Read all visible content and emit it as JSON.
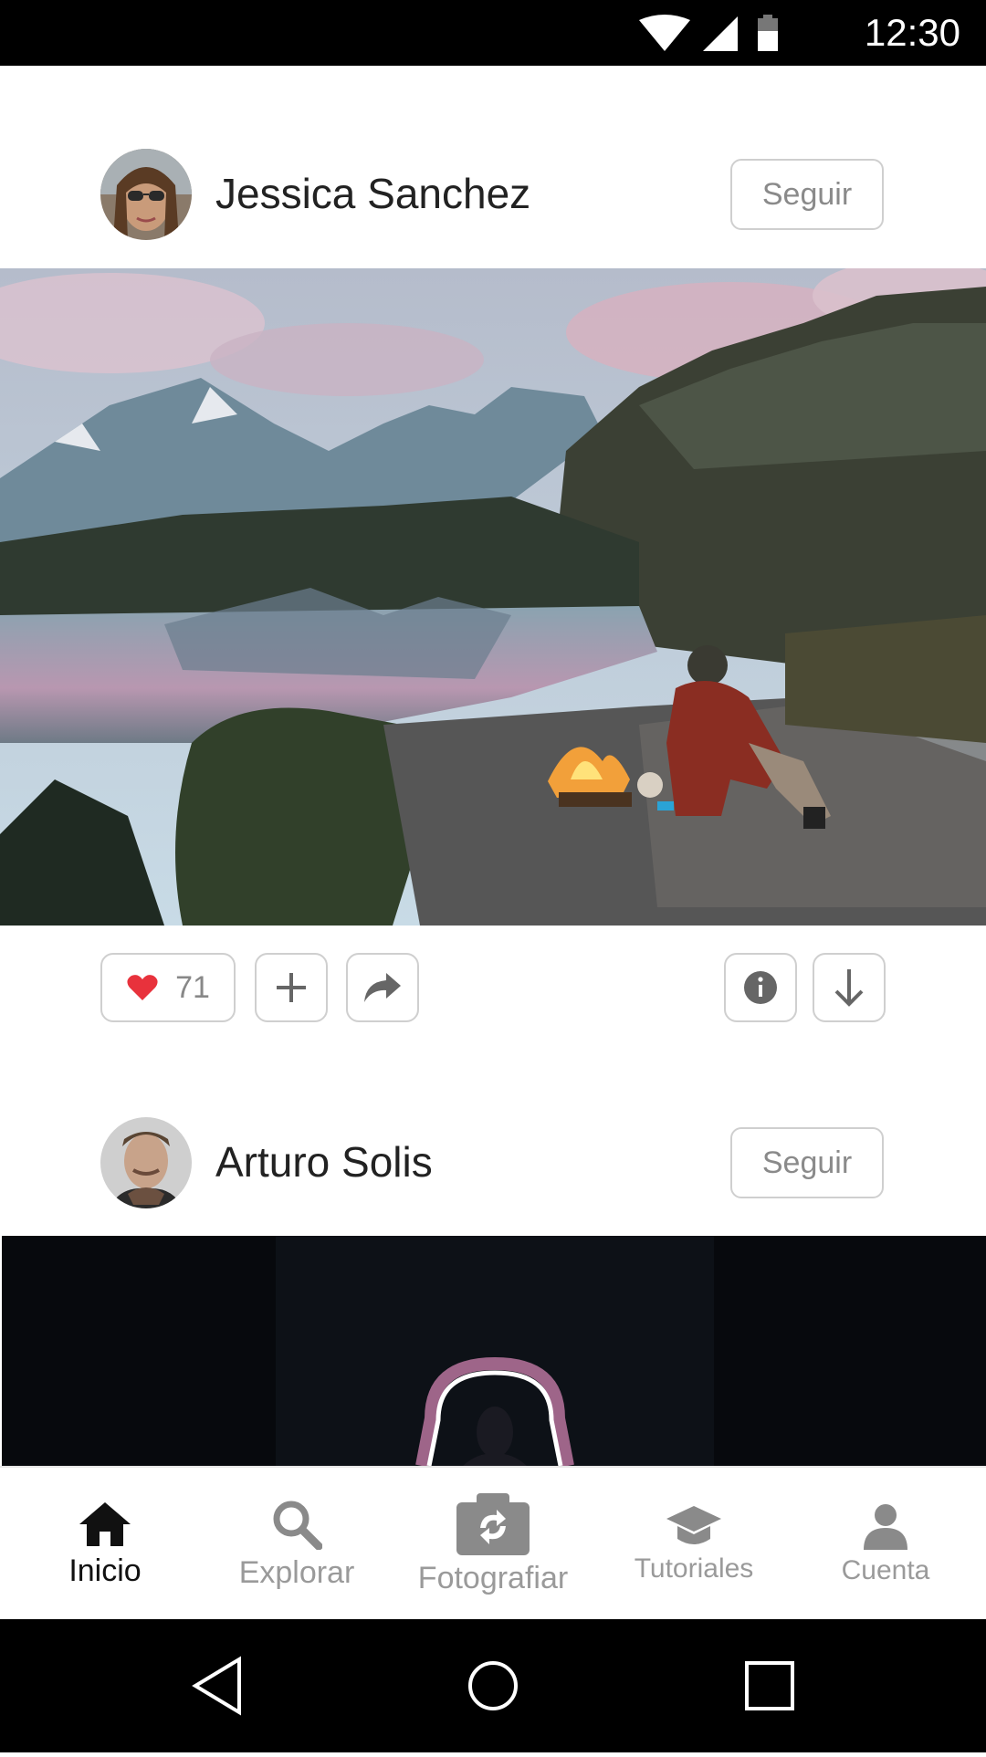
{
  "status_bar": {
    "time": "12:30",
    "icons": [
      "wifi-icon",
      "signal-icon",
      "battery-icon"
    ]
  },
  "feed": [
    {
      "author": "Jessica Sanchez",
      "follow_label": "Seguir",
      "likes": "71"
    },
    {
      "author": "Arturo Solis",
      "follow_label": "Seguir"
    }
  ],
  "tabs": [
    {
      "label": "Inicio",
      "icon": "home-icon",
      "active": true
    },
    {
      "label": "Explorar",
      "icon": "search-icon"
    },
    {
      "label": "Fotografiar",
      "icon": "camera-icon"
    },
    {
      "label": "Tutoriales",
      "icon": "graduation-cap-icon"
    },
    {
      "label": "Cuenta",
      "icon": "user-icon"
    }
  ],
  "colors": {
    "heart": "#e8323c",
    "border": "#cfcfcf",
    "muted_text": "#8a8a8a",
    "active_tab": "#111111"
  }
}
